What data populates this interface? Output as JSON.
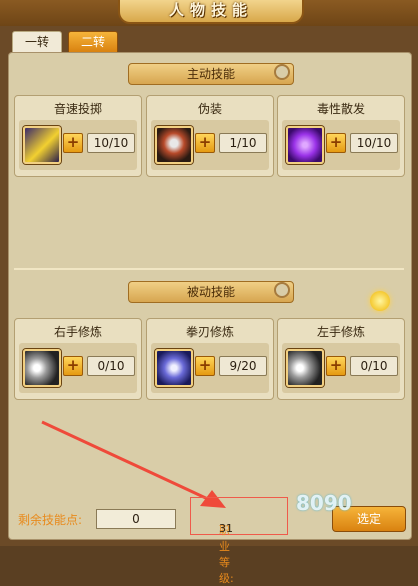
{
  "window": {
    "title": "人物技能"
  },
  "tabs": [
    {
      "label": "一转"
    },
    {
      "label": "二转"
    }
  ],
  "active_skills": {
    "title": "主动技能",
    "items": [
      {
        "name": "音速投掷",
        "level": "10/10",
        "icon": "lightning-strike-icon"
      },
      {
        "name": "伪装",
        "level": "1/10",
        "icon": "disguise-figure-icon"
      },
      {
        "name": "毒性散发",
        "level": "10/10",
        "icon": "poison-burst-icon"
      }
    ]
  },
  "passive_skills": {
    "title": "被动技能",
    "items": [
      {
        "name": "右手修炼",
        "level": "0/10",
        "icon": "right-hand-training-icon"
      },
      {
        "name": "拳刃修炼",
        "level": "9/20",
        "icon": "fist-blade-icon"
      },
      {
        "name": "左手修炼",
        "level": "0/10",
        "icon": "left-hand-training-icon"
      }
    ]
  },
  "footer": {
    "remaining_points_label": "剩余技能点:",
    "remaining_points": "0",
    "job_level_label": "职业等级:",
    "job_level": "31",
    "confirm_label": "选定"
  },
  "watermark": "8090"
}
